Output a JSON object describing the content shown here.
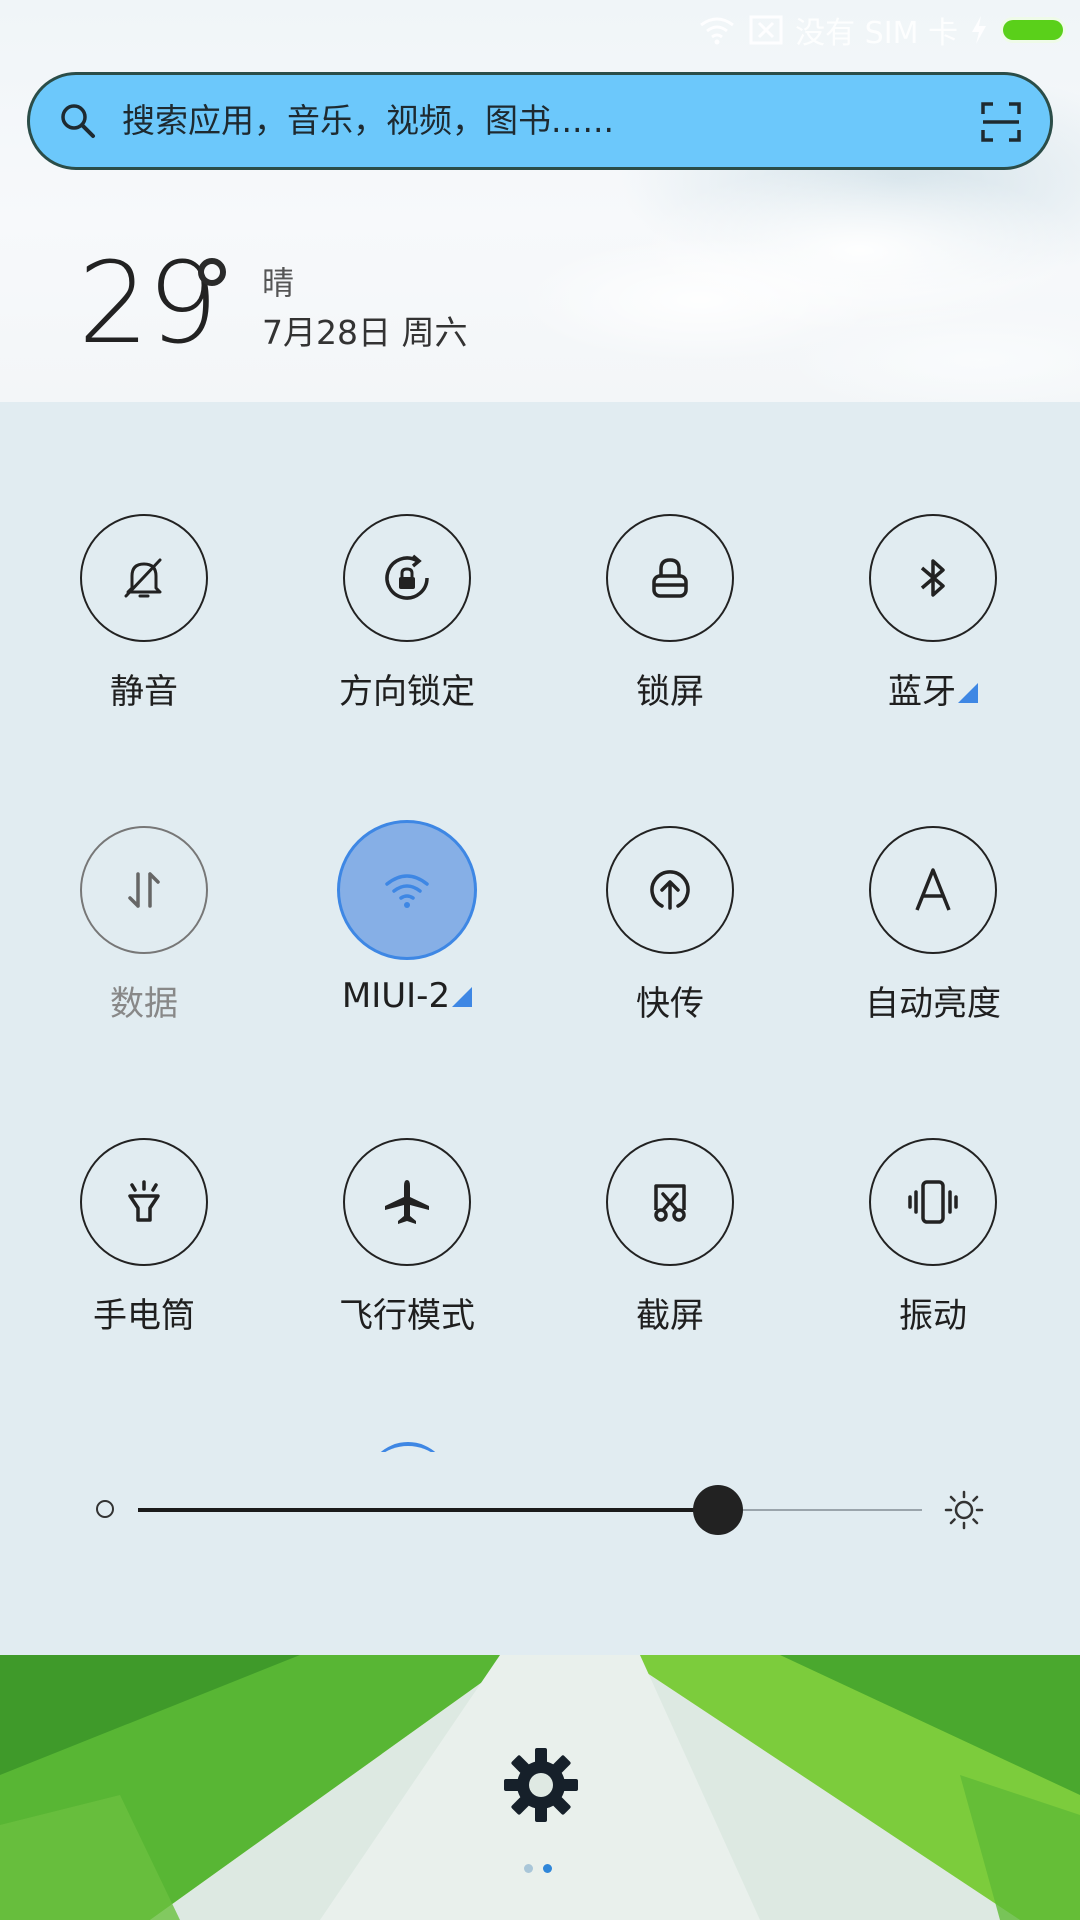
{
  "status_bar": {
    "sim_text": "没有 SIM 卡",
    "battery_color": "#5ad01a",
    "icons": [
      "wifi-icon",
      "no-sim-icon",
      "charging-icon",
      "battery-icon"
    ]
  },
  "search": {
    "placeholder": "搜索应用，音乐，视频，图书......",
    "left_icon": "search-icon",
    "right_icon": "scan-icon",
    "background": "#6cc8fb"
  },
  "weather": {
    "temperature": "29",
    "condition": "晴",
    "date": "7月28日 周六"
  },
  "toggles": [
    {
      "label": "静音",
      "icon": "silent-bell-icon",
      "state": "off"
    },
    {
      "label": "方向锁定",
      "icon": "rotation-lock-icon",
      "state": "off"
    },
    {
      "label": "锁屏",
      "icon": "lock-icon",
      "state": "off"
    },
    {
      "label": "蓝牙",
      "icon": "bluetooth-icon",
      "state": "off",
      "has_submenu": true
    },
    {
      "label": "数据",
      "icon": "mobile-data-icon",
      "state": "disabled"
    },
    {
      "label": "MIUI-2",
      "icon": "wifi-icon",
      "state": "on",
      "has_submenu": true
    },
    {
      "label": "快传",
      "icon": "quick-transfer-icon",
      "state": "off"
    },
    {
      "label": "自动亮度",
      "icon": "auto-brightness-icon",
      "state": "off"
    },
    {
      "label": "手电筒",
      "icon": "flashlight-icon",
      "state": "off"
    },
    {
      "label": "飞行模式",
      "icon": "airplane-icon",
      "state": "off"
    },
    {
      "label": "截屏",
      "icon": "screenshot-icon",
      "state": "off"
    },
    {
      "label": "振动",
      "icon": "vibrate-icon",
      "state": "off"
    }
  ],
  "brightness": {
    "level": 0.74,
    "min_icon": "dim-brightness-icon",
    "max_icon": "sun-brightness-icon"
  },
  "bottom": {
    "settings_icon": "gear-icon",
    "page_count": 2,
    "active_page": 2
  },
  "colors": {
    "accent": "#3e87e4",
    "active_fill": "#86afe6",
    "panel_bg": "#e1ecf1"
  }
}
